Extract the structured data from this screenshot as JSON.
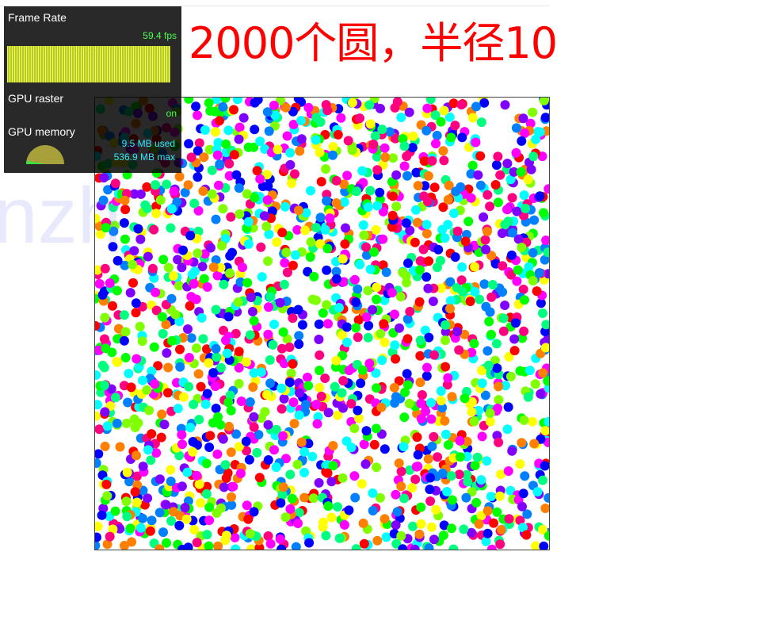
{
  "heading": "2000个圆，半径10",
  "watermark": "nzh",
  "hud": {
    "frame_rate_label": "Frame Rate",
    "fps_value": "59.4 fps",
    "gpu_raster_label": "GPU raster",
    "gpu_raster_value": "on",
    "gpu_memory_label": "GPU memory",
    "memory_used": "9.5 MB used",
    "memory_max": "536.9 MB max",
    "memory_used_fraction": 0.018
  },
  "circles": {
    "count": 2000,
    "radius": 10,
    "palette": [
      "#ff0000",
      "#ff0080",
      "#ff00ff",
      "#8000ff",
      "#0000ff",
      "#0080ff",
      "#00ffff",
      "#00ff80",
      "#00ff00",
      "#80ff00",
      "#ffff00",
      "#ff8000"
    ]
  },
  "colors": {
    "heading": "#ff0000",
    "fps": "#4cff4c",
    "memory": "#30e8ff",
    "graph_bar": "#f0ff40"
  }
}
